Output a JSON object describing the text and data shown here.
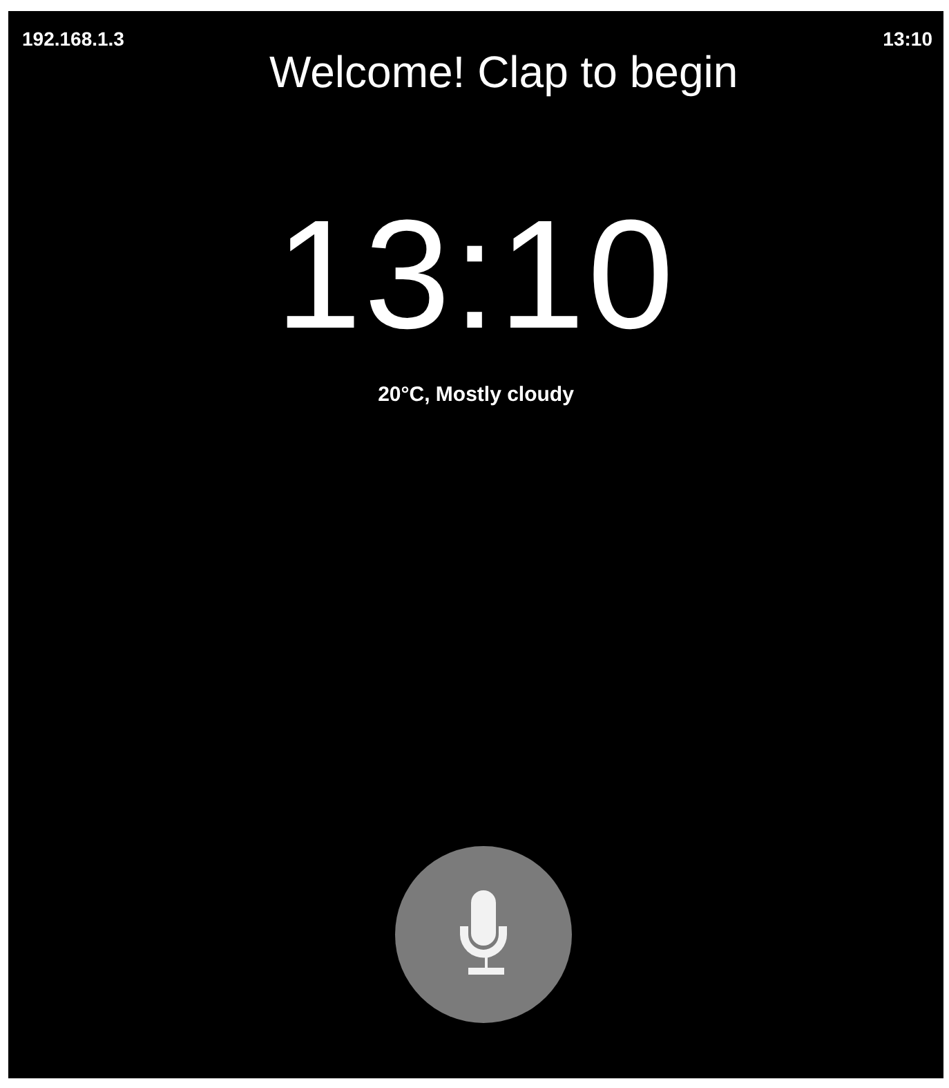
{
  "status_bar": {
    "address": "192.168.1.3",
    "time": "13:10"
  },
  "title": "Welcome! Clap to begin",
  "clock": {
    "time": "13:10",
    "weather": "20°C, Mostly cloudy"
  },
  "mic_button": {
    "kind": "microphone"
  }
}
